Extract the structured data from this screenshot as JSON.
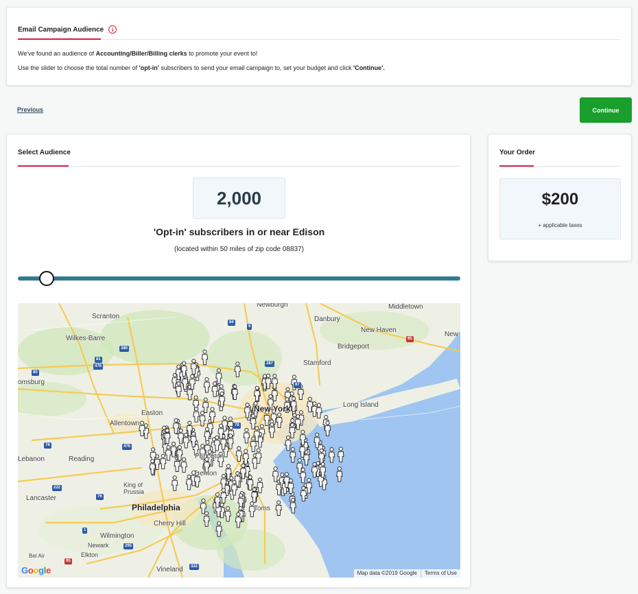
{
  "intro": {
    "title": "Email Campaign Audience",
    "line1_prefix": "We've found an audience of ",
    "line1_bold": "Accounting/Biller/Billing clerks",
    "line1_suffix": " to promote your event to!",
    "line2_a": "Use the slider to choose the total number of ",
    "line2_b": "'opt-in'",
    "line2_c": " subscribers to send your email campaign to, set your budget and click ",
    "line2_d": "'Continue'."
  },
  "nav": {
    "previous_label": "Previous",
    "continue_label": "Continue"
  },
  "audience": {
    "title": "Select Audience",
    "count": "2,000",
    "count_label": "'Opt-in' subscribers in or near Edison",
    "count_sub": "(located within 50 miles of zip code 08837)",
    "slider_fraction": 0.065
  },
  "map": {
    "cities": [
      "Newburgh",
      "Middletown",
      "Scranton",
      "Danbury",
      "New Haven",
      "Wilkes-Barre",
      "Bridgeport",
      "Stamford",
      "New",
      "omsburg",
      "New York",
      "Long Island",
      "Allentown",
      "Easton",
      "Lebanon",
      "Reading",
      "King of Prussia",
      "Lancaster",
      "Philadelphia",
      "Cherry Hill",
      "Wilmington",
      "Newark",
      "Elkton",
      "Vineland",
      "Princeton",
      "Trenton",
      "Toms",
      "Bel Air"
    ],
    "highways": [
      "84",
      "6",
      "380",
      "81",
      "476",
      "80",
      "287",
      "95",
      "87",
      "78",
      "76",
      "222",
      "1",
      "295",
      "322"
    ],
    "google_logo": "Google",
    "attribution": "Map data ©2019 Google",
    "terms": "Terms of Use"
  },
  "order": {
    "title": "Your Order",
    "price": "$200",
    "price_sub": "+ applicable taxes"
  },
  "colors": {
    "accent": "#d0213e",
    "continue": "#1a9e2c",
    "slider": "#337a92",
    "water": "#9fc5f0"
  }
}
